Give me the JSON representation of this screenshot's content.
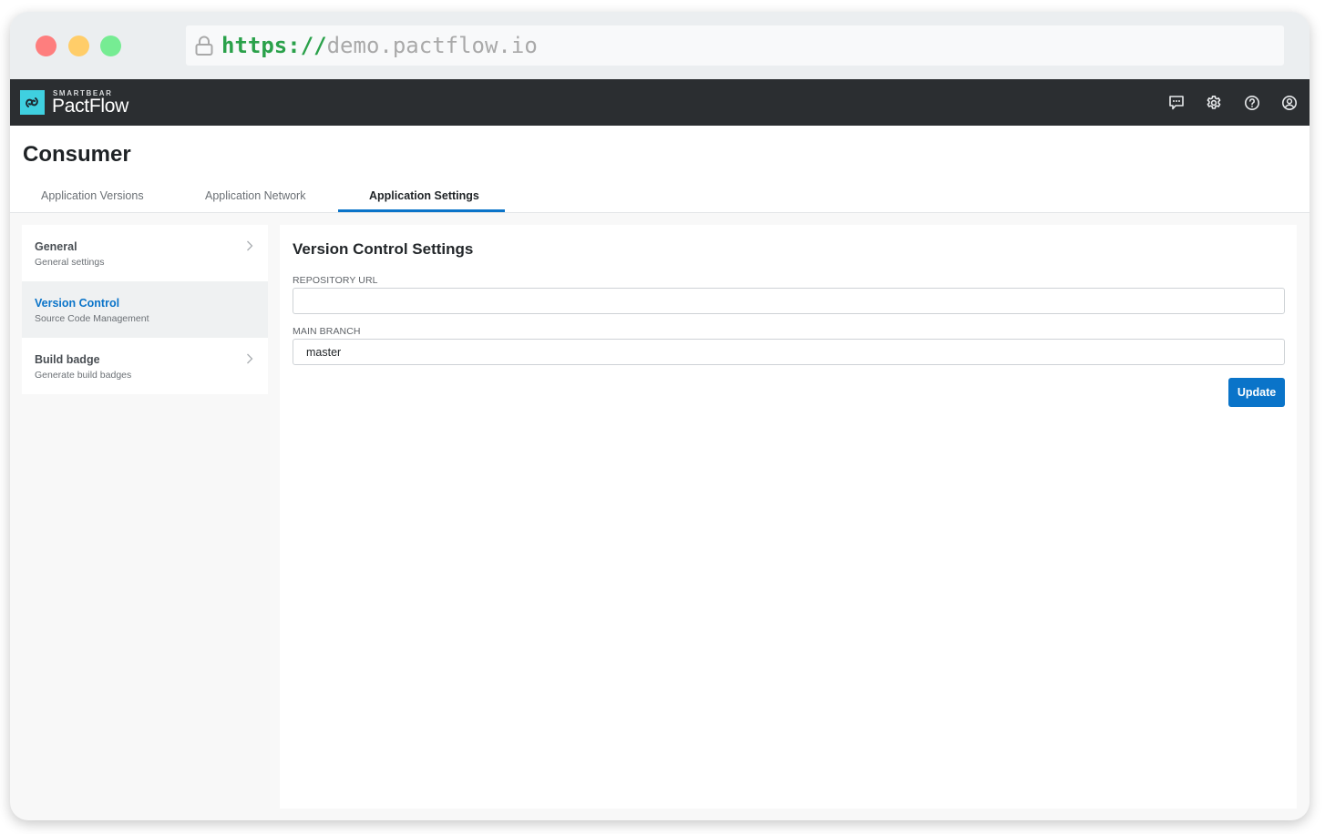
{
  "browser": {
    "url_scheme": "https://",
    "url_host": "demo.pactflow.io"
  },
  "appbar": {
    "brand_small": "SMARTBEAR",
    "brand_name": "PactFlow",
    "icons": [
      "chat-icon",
      "settings-gear-icon",
      "help-icon",
      "user-account-icon"
    ]
  },
  "header": {
    "title": "Consumer",
    "tabs": [
      {
        "label": "Application Versions",
        "active": false
      },
      {
        "label": "Application Network",
        "active": false
      },
      {
        "label": "Application Settings",
        "active": true
      }
    ]
  },
  "sidenav": {
    "items": [
      {
        "title": "General",
        "subtitle": "General settings",
        "active": false
      },
      {
        "title": "Version Control",
        "subtitle": "Source Code Management",
        "active": true
      },
      {
        "title": "Build badge",
        "subtitle": "Generate build badges",
        "active": false
      }
    ]
  },
  "panel": {
    "title": "Version Control Settings",
    "repository_url": {
      "label": "REPOSITORY URL",
      "value": ""
    },
    "main_branch": {
      "label": "MAIN BRANCH",
      "value": "master"
    },
    "update_label": "Update"
  },
  "colors": {
    "accent": "#0a74c9",
    "appbar_bg": "#2b2e31",
    "logo": "#3fd0e0",
    "url_scheme": "#2aa14a"
  }
}
